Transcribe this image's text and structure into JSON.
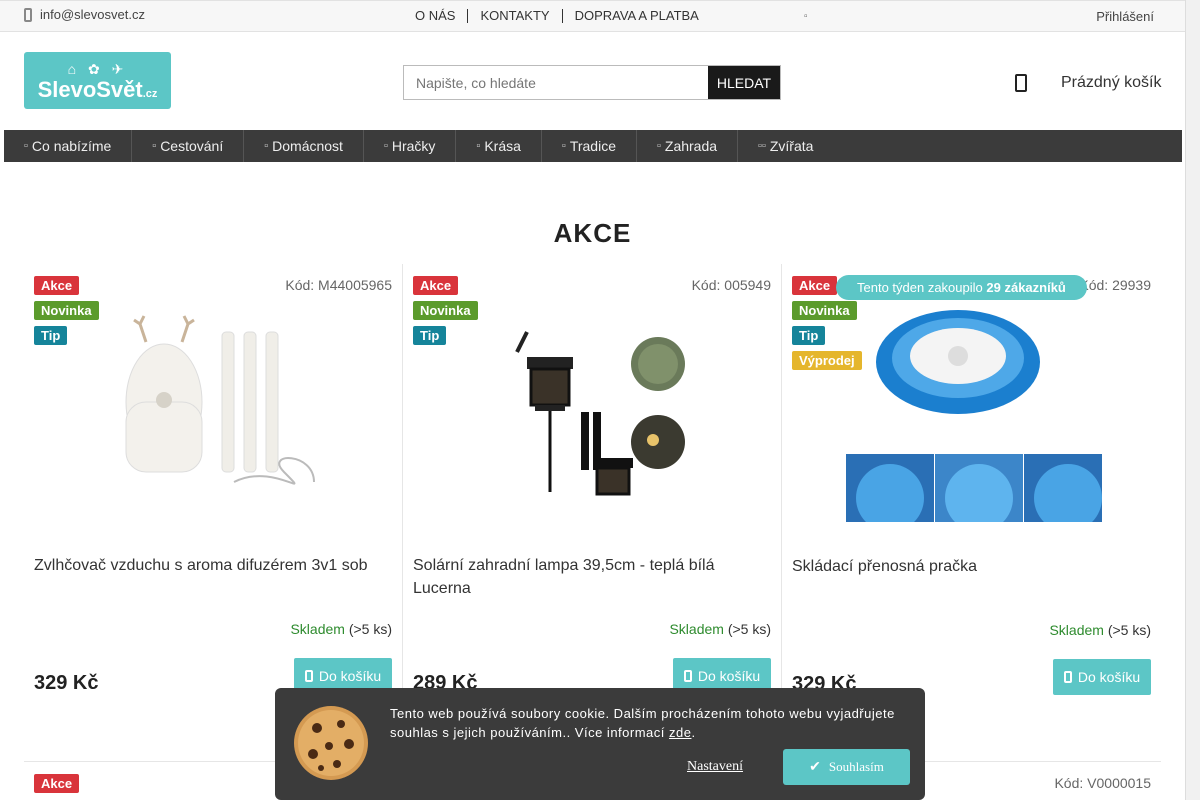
{
  "topbar": {
    "email": "info@slevosvet.cz",
    "nav": [
      "O NÁS",
      "KONTAKTY",
      "DOPRAVA A PLATBA"
    ],
    "flag": "▫",
    "login": "Přihlášení"
  },
  "header": {
    "logo_icons": "⌂ ✿ ✈",
    "logo_text": "SlevoSvět",
    "logo_domain": ".cz",
    "search_placeholder": "Napište, co hledáte",
    "search_button": "HLEDAT",
    "cart_text": "Prázdný košík"
  },
  "nav": {
    "items": [
      {
        "icon": "▫",
        "label": "Co nabízíme"
      },
      {
        "icon": "▫",
        "label": "Cestování"
      },
      {
        "icon": "▫",
        "label": "Domácnost"
      },
      {
        "icon": "▫",
        "label": "Hračky"
      },
      {
        "icon": "▫",
        "label": "Krása"
      },
      {
        "icon": "▫",
        "label": "Tradice"
      },
      {
        "icon": "▫",
        "label": "Zahrada"
      },
      {
        "icon": "▫▫",
        "label": "Zvířata"
      }
    ]
  },
  "heading": "AKCE",
  "products": [
    {
      "badges": [
        "Akce",
        "Novinka",
        "Tip"
      ],
      "code": "Kód: M44005965",
      "name": "Zvlhčovač vzduchu s aroma difuzérem 3v1 sob",
      "stock_label": "Skladem",
      "stock_qty": "(>5 ks)",
      "price": "329 Kč",
      "buy": "Do košíku"
    },
    {
      "badges": [
        "Akce",
        "Novinka",
        "Tip"
      ],
      "code": "Kód: 005949",
      "name": "Solární zahradní lampa 39,5cm - teplá bílá Lucerna",
      "stock_label": "Skladem",
      "stock_qty": "(>5 ks)",
      "price": "289 Kč",
      "buy": "Do košíku"
    },
    {
      "badges": [
        "Akce",
        "Novinka",
        "Tip",
        "Výprodej"
      ],
      "code": "Kód: 29939",
      "bought_pre": "Tento týden zakoupilo",
      "bought_count": "29 zákazníků",
      "name": "Skládací přenosná pračka",
      "stock_label": "Skladem",
      "stock_qty": "(>5 ks)",
      "price": "329 Kč",
      "buy": "Do košíku"
    }
  ],
  "row2": {
    "badge": "Akce",
    "code": "Kód: V0000015"
  },
  "cookie": {
    "text_1": "Tento web používá soubory cookie. Dalším procházením tohoto webu vyjadřujete souhlas s jejich používáním.. Více informací",
    "link": "zde",
    "text_2": ".",
    "settings": "Nastavení",
    "agree": "Souhlasím"
  }
}
